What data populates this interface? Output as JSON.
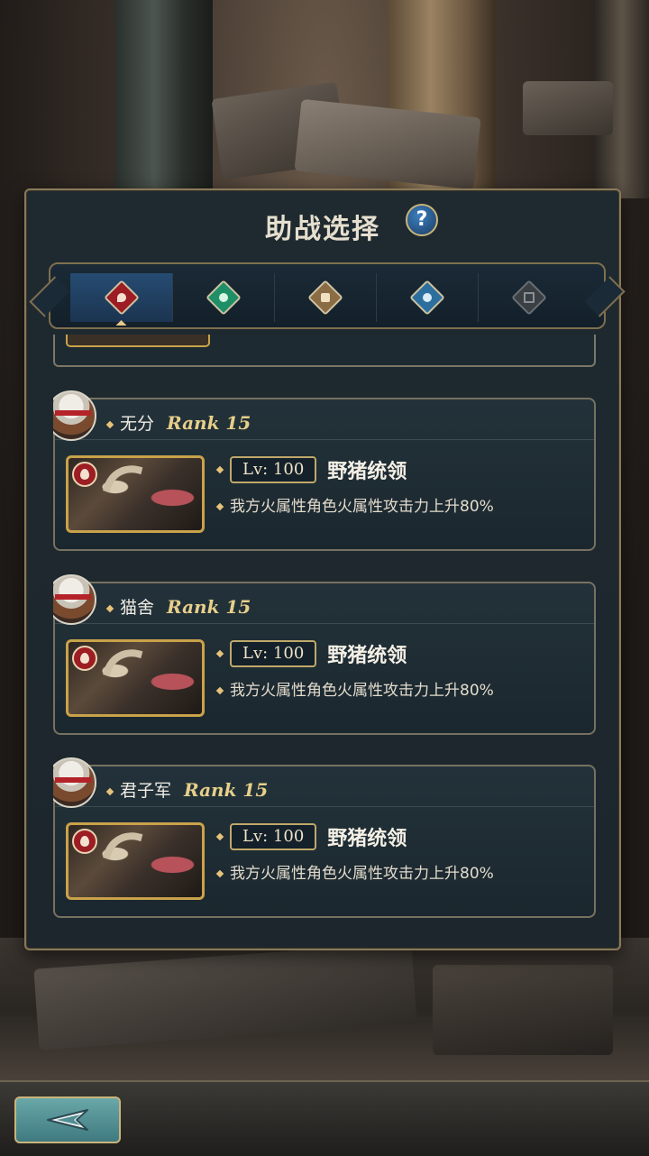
{
  "title": "助战选择",
  "help_symbol": "?",
  "tabs": [
    {
      "name": "fire-element-icon",
      "color": "#9c1d23",
      "active": true
    },
    {
      "name": "wind-element-icon",
      "color": "#1f8f68",
      "active": false
    },
    {
      "name": "earth-element-icon",
      "color": "#8a6c45",
      "active": false
    },
    {
      "name": "water-element-icon",
      "color": "#2c6f9e",
      "active": false
    },
    {
      "name": "neutral-element-icon",
      "color": "#3a3f44",
      "active": false
    }
  ],
  "supports": [
    {
      "player": "无分",
      "rank": "Rank 15",
      "level": "Lv: 100",
      "summon": "野猪统领",
      "effect": "我方火属性角色火属性攻击力上升80%"
    },
    {
      "player": "猫舍",
      "rank": "Rank 15",
      "level": "Lv: 100",
      "summon": "野猪统领",
      "effect": "我方火属性角色火属性攻击力上升80%"
    },
    {
      "player": "君子军",
      "rank": "Rank 15",
      "level": "Lv: 100",
      "summon": "野猪统领",
      "effect": "我方火属性角色火属性攻击力上升80%"
    }
  ],
  "footer": {
    "back_icon": "back-arrow-icon"
  }
}
